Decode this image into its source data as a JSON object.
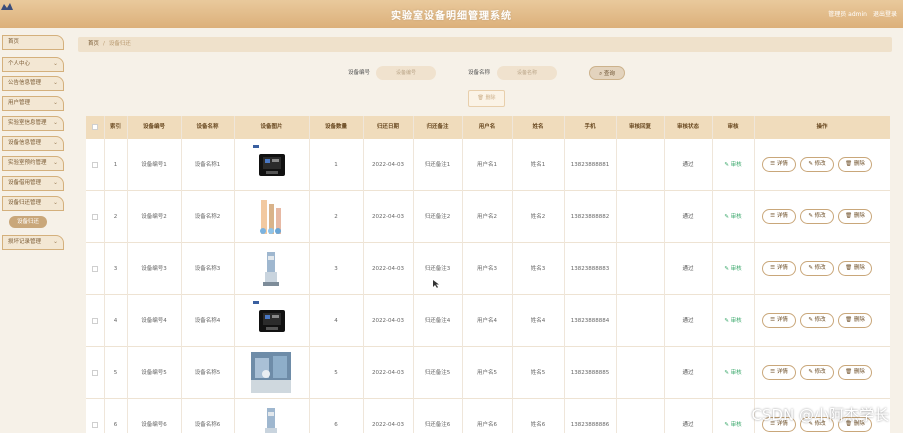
{
  "header": {
    "title": "实验室设备明细管理系统",
    "user": "管理员 admin",
    "logout": "退出登录"
  },
  "sidebar": {
    "items": [
      {
        "label": "首页",
        "has_chevron": false
      },
      {
        "label": "个人中心",
        "has_chevron": true
      },
      {
        "label": "公告信息管理",
        "has_chevron": true
      },
      {
        "label": "用户管理",
        "has_chevron": true
      },
      {
        "label": "实验室信息管理",
        "has_chevron": true
      },
      {
        "label": "设备信息管理",
        "has_chevron": true
      },
      {
        "label": "实验室预约管理",
        "has_chevron": true
      },
      {
        "label": "设备借用管理",
        "has_chevron": true
      },
      {
        "label": "设备归还管理",
        "has_chevron": true
      },
      {
        "label": "损坏记录管理",
        "has_chevron": true
      }
    ],
    "active_sub": "设备归还"
  },
  "breadcrumb": {
    "home": "首页",
    "current": "设备归还"
  },
  "search": {
    "label1": "设备编号",
    "placeholder1": "设备编号",
    "label2": "设备名称",
    "placeholder2": "设备名称",
    "query": "查询"
  },
  "delete_button": "删除",
  "table": {
    "headers": [
      "",
      "索引",
      "设备编号",
      "设备名称",
      "设备图片",
      "设备数量",
      "归还日期",
      "归还备注",
      "用户名",
      "姓名",
      "手机",
      "审核回复",
      "审核状态",
      "审核",
      "操作"
    ],
    "actions": {
      "detail": "详情",
      "edit": "修改",
      "delete": "删除"
    },
    "review_label": "审核",
    "rows": [
      {
        "index": "1",
        "code": "设备编号1",
        "name": "设备名称1",
        "qty": "1",
        "date": "2022-04-03",
        "note": "归还备注1",
        "user": "用户名1",
        "person": "姓名1",
        "phone": "13823888881",
        "reply": "",
        "status": "通过",
        "img": "case"
      },
      {
        "index": "2",
        "code": "设备编号2",
        "name": "设备名称2",
        "qty": "2",
        "date": "2022-04-03",
        "note": "归还备注2",
        "user": "用户名2",
        "person": "姓名2",
        "phone": "13823888882",
        "reply": "",
        "status": "通过",
        "img": "tubes"
      },
      {
        "index": "3",
        "code": "设备编号3",
        "name": "设备名称3",
        "qty": "3",
        "date": "2022-04-03",
        "note": "归还备注3",
        "user": "用户名3",
        "person": "姓名3",
        "phone": "13823888883",
        "reply": "",
        "status": "通过",
        "img": "device"
      },
      {
        "index": "4",
        "code": "设备编号4",
        "name": "设备名称4",
        "qty": "4",
        "date": "2022-04-03",
        "note": "归还备注4",
        "user": "用户名4",
        "person": "姓名4",
        "phone": "13823888884",
        "reply": "",
        "status": "通过",
        "img": "case"
      },
      {
        "index": "5",
        "code": "设备编号5",
        "name": "设备名称5",
        "qty": "5",
        "date": "2022-04-03",
        "note": "归还备注5",
        "user": "用户名5",
        "person": "姓名5",
        "phone": "13823888885",
        "reply": "",
        "status": "通过",
        "img": "lab"
      },
      {
        "index": "6",
        "code": "设备编号6",
        "name": "设备名称6",
        "qty": "6",
        "date": "2022-04-03",
        "note": "归还备注6",
        "user": "用户名6",
        "person": "姓名6",
        "phone": "13823888886",
        "reply": "",
        "status": "通过",
        "img": "device"
      }
    ]
  },
  "watermark": "CSDN @小阿杰学长",
  "colors": {
    "header": "#dcb07a",
    "accent": "#c9a77a",
    "approved": "#3aa86b",
    "table_head": "#f0dcbc"
  }
}
